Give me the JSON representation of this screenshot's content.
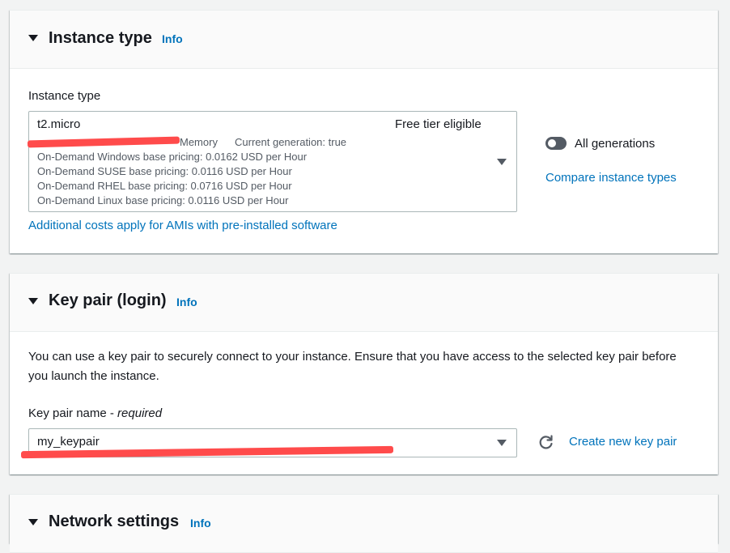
{
  "instance_type_section": {
    "title": "Instance type",
    "info": "Info",
    "field_label": "Instance type",
    "selected_type": "t2.micro",
    "free_tier_badge": "Free tier eligible",
    "memory_label": "Memory",
    "current_generation": "Current generation: true",
    "pricing_lines": [
      "On-Demand Windows base pricing: 0.0162 USD per Hour",
      "On-Demand SUSE base pricing: 0.0116 USD per Hour",
      "On-Demand RHEL base pricing: 0.0716 USD per Hour",
      "On-Demand Linux base pricing: 0.0116 USD per Hour"
    ],
    "toggle_label": "All generations",
    "toggle_on": false,
    "compare_link": "Compare instance types",
    "costs_link": "Additional costs apply for AMIs with pre-installed software"
  },
  "key_pair_section": {
    "title": "Key pair (login)",
    "info": "Info",
    "description": "You can use a key pair to securely connect to your instance. Ensure that you have access to the selected key pair before you launch the instance.",
    "field_label": "Key pair name - ",
    "field_label_required": "required",
    "selected_key": "my_keypair",
    "create_link": "Create new key pair"
  },
  "network_section": {
    "title": "Network settings",
    "info": "Info"
  },
  "colors": {
    "link": "#0073bb",
    "redaction": "#ff4b4b",
    "background": "#f2f3f3"
  }
}
